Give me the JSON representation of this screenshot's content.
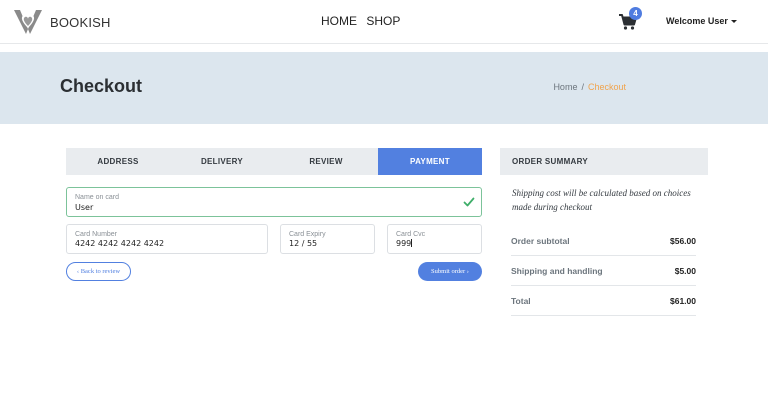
{
  "navbar": {
    "brand": "BOOKISH",
    "links": [
      "HOME",
      "SHOP"
    ],
    "cart_count": "4",
    "user_menu": "Welcome User"
  },
  "hero": {
    "title": "Checkout",
    "breadcrumb": {
      "home": "Home",
      "separator": "/",
      "current": "Checkout"
    }
  },
  "steps": [
    {
      "label": "ADDRESS",
      "active": false
    },
    {
      "label": "DELIVERY",
      "active": false
    },
    {
      "label": "REVIEW",
      "active": false
    },
    {
      "label": "PAYMENT",
      "active": true
    }
  ],
  "form": {
    "name_on_card": {
      "label": "Name on card",
      "value": "User"
    },
    "card_number": {
      "label": "Card Number",
      "value": "4242 4242 4242 4242"
    },
    "card_expiry": {
      "label": "Card Expiry",
      "value": "12 / 55"
    },
    "card_cvc": {
      "label": "Card Cvc",
      "value": "999"
    },
    "back_button": "‹ Back to review",
    "submit_button": "Submit order ›"
  },
  "summary": {
    "title": "ORDER SUMMARY",
    "note": "Shipping cost will be calculated based on choices made during checkout",
    "rows": [
      {
        "label": "Order subtotal",
        "value": "$56.00"
      },
      {
        "label": "Shipping and handling",
        "value": "$5.00"
      },
      {
        "label": "Total",
        "value": "$61.00"
      }
    ]
  },
  "colors": {
    "accent": "#5280e0",
    "breadcrumb_active": "#f0a44e",
    "valid_border": "#7cc39a",
    "hero_bg": "#dce6ee"
  }
}
